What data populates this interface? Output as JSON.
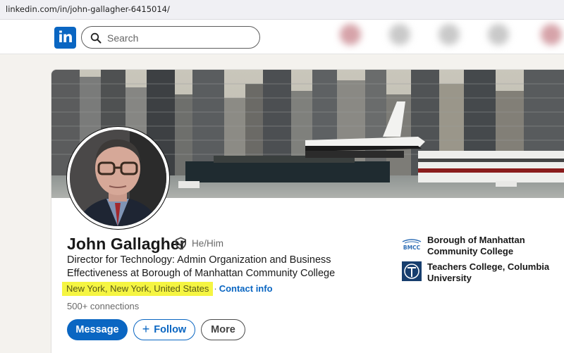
{
  "browser": {
    "url": "linkedin.com/in/john-gallagher-6415014/"
  },
  "nav": {
    "logo_text": "in",
    "search_placeholder": "Search"
  },
  "profile": {
    "name": "John Gallagher",
    "pronouns": "He/Him",
    "headline": "Director for Technology: Admin Organization and Business Effectiveness at Borough of Manhattan Community College",
    "location": "New York, New York, United States",
    "separator": "·",
    "contact_label": "Contact info",
    "connections": "500+ connections",
    "location_highlight_color": "#f5f542"
  },
  "actions": {
    "message": "Message",
    "follow": "Follow",
    "follow_icon": "+",
    "more": "More"
  },
  "education": [
    {
      "name": "Borough of Manhattan Community College",
      "logo_text": "BMCC"
    },
    {
      "name": "Teachers College, Columbia University"
    }
  ],
  "colors": {
    "brand": "#0a66c2",
    "page_bg": "#f4f2ee"
  }
}
